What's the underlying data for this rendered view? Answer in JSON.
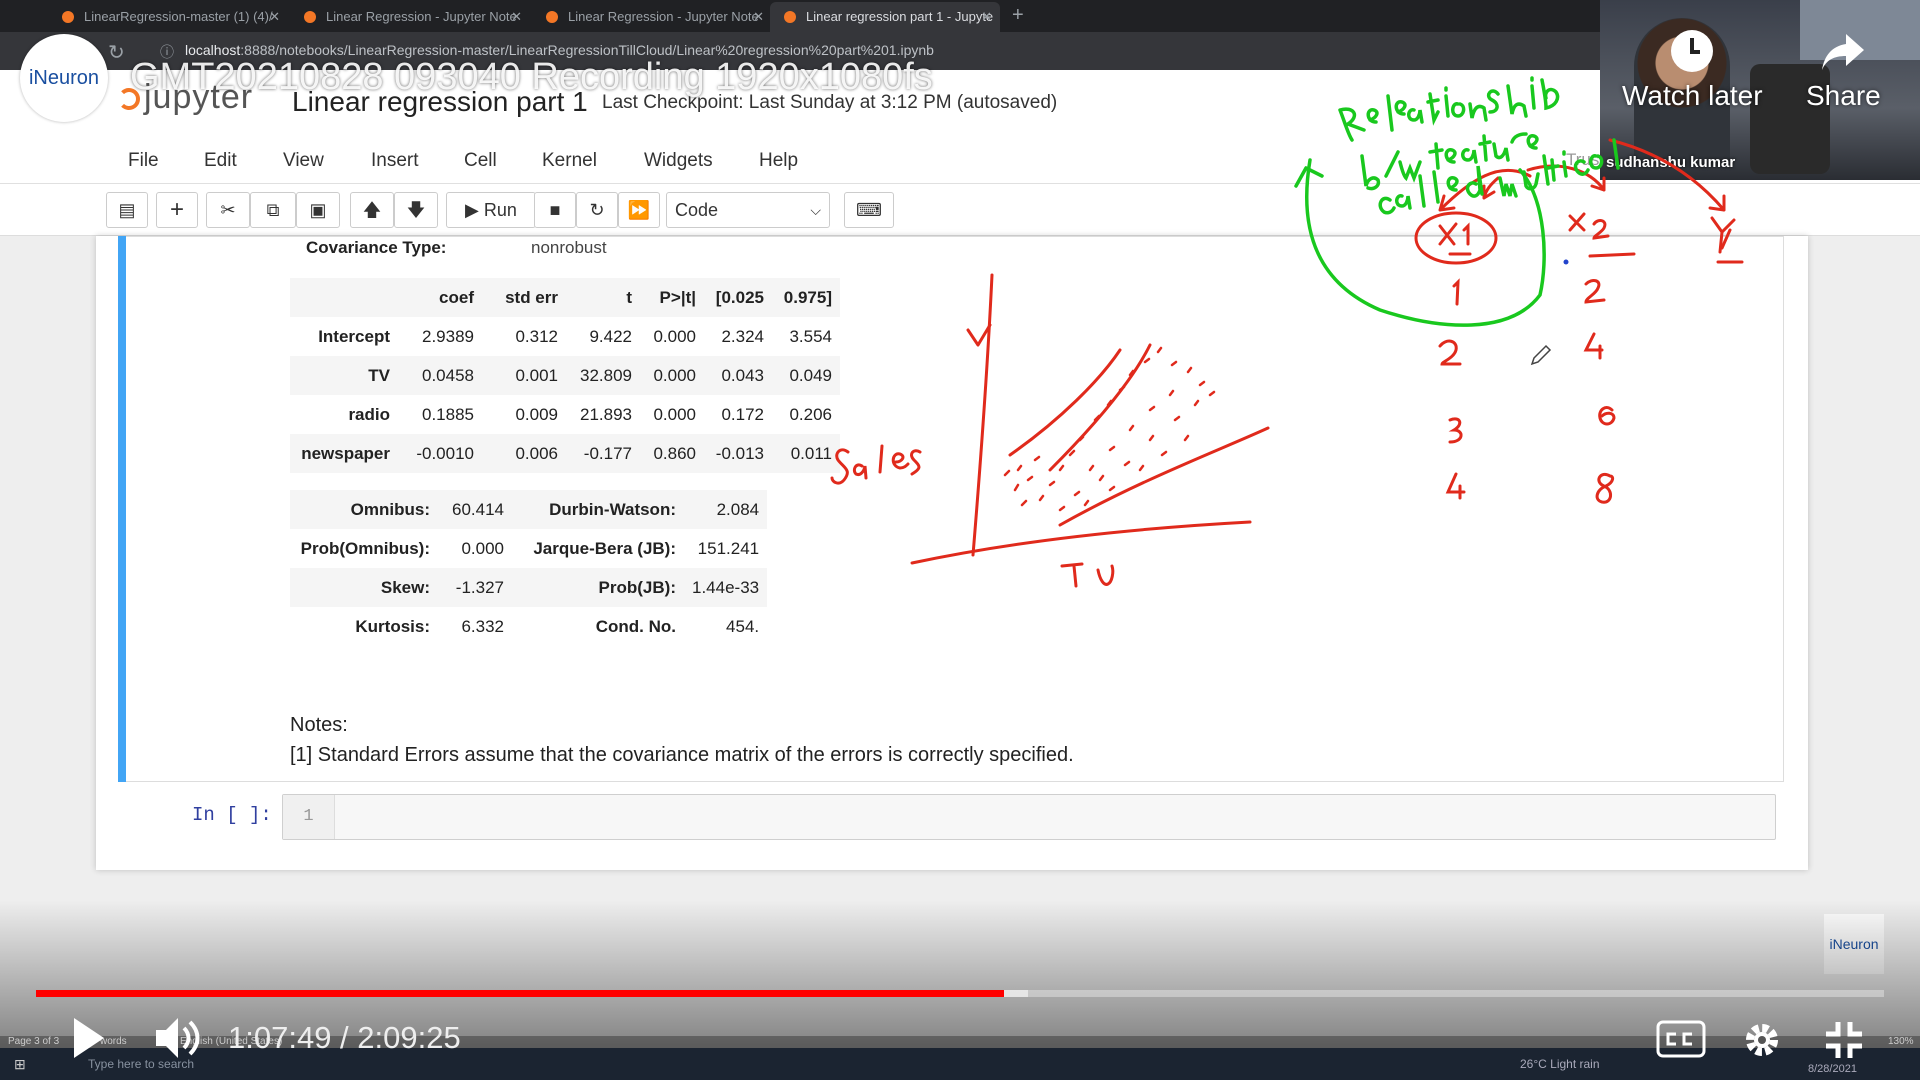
{
  "browser": {
    "tabs": [
      {
        "label": "LinearRegression-master (1) (4)/",
        "active": false
      },
      {
        "label": "Linear Regression - Jupyter Note",
        "active": false
      },
      {
        "label": "Linear Regression - Jupyter Note",
        "active": false
      },
      {
        "label": "Linear regression part 1 - Jupyte",
        "active": true
      }
    ],
    "url_host": "localhost",
    "url_path": ":8888/notebooks/LinearRegression-master/LinearRegressionTillCloud/Linear%20regression%20part%201.ipynb"
  },
  "video": {
    "title": "GMT20210828 093040 Recording 1920x1080fs",
    "channel_logo_text": "iNeuron",
    "watch_later": "Watch later",
    "share": "Share",
    "presenter": "sudhanshu kumar",
    "time_current": "1:07:49",
    "time_total": "2:09:25",
    "time_display": "1:07:49 / 2:09:25",
    "progress_played": 0.524,
    "progress_buffered": 0.537,
    "watermark_text": "iNeuron"
  },
  "jupyter": {
    "logo_text": "jupyter",
    "notebook_title": "Linear regression part 1",
    "checkpoint": "Last Checkpoint: Last Sunday at 3:12 PM  (autosaved)",
    "trusted": "Trus",
    "menu": [
      "File",
      "Edit",
      "View",
      "Insert",
      "Cell",
      "Kernel",
      "Widgets",
      "Help"
    ],
    "run_label": "Run",
    "cell_type": "Code"
  },
  "output": {
    "cov_type_label": "Covariance Type:",
    "cov_type_value": "nonrobust",
    "coef_headers": [
      "",
      "coef",
      "std err",
      "t",
      "P>|t|",
      "[0.025",
      "0.975]"
    ],
    "coef_rows": [
      [
        "Intercept",
        "2.9389",
        "0.312",
        "9.422",
        "0.000",
        "2.324",
        "3.554"
      ],
      [
        "TV",
        "0.0458",
        "0.001",
        "32.809",
        "0.000",
        "0.043",
        "0.049"
      ],
      [
        "radio",
        "0.1885",
        "0.009",
        "21.893",
        "0.000",
        "0.172",
        "0.206"
      ],
      [
        "newspaper",
        "-0.0010",
        "0.006",
        "-0.177",
        "0.860",
        "-0.013",
        "0.011"
      ]
    ],
    "diag_rows": [
      [
        "Omnibus:",
        "60.414",
        "Durbin-Watson:",
        "2.084"
      ],
      [
        "Prob(Omnibus):",
        "0.000",
        "Jarque-Bera (JB):",
        "151.241"
      ],
      [
        "Skew:",
        "-1.327",
        "Prob(JB):",
        "1.44e-33"
      ],
      [
        "Kurtosis:",
        "6.332",
        "Cond. No.",
        "454."
      ]
    ],
    "notes_title": "Notes:",
    "notes_text": "[1] Standard Errors assume that the covariance matrix of the errors is correctly specified."
  },
  "input_cell": {
    "prompt": "In [ ]:",
    "line_number": "1"
  },
  "annotations": {
    "green_text_line1": "Releationship",
    "green_text_line2": "b/w features",
    "green_text_line3": "called multicol",
    "circled": "X1",
    "x2_label": "X2",
    "y_label": "Y",
    "col1": [
      "1",
      "2",
      "3",
      "4"
    ],
    "col2": [
      "2",
      "4",
      "6",
      "8"
    ],
    "sales_label": "Sales",
    "tv_label": "TV",
    "y_axis_mark": "Y",
    "colors": {
      "green": "#19c81e",
      "red": "#e02a1c"
    }
  },
  "taskbar": {
    "search_placeholder": "Type here to search",
    "page_info": "Page 3 of 3",
    "words": "words",
    "lang": "English (United States)",
    "weather": "26°C  Light rain",
    "date": "8/28/2021",
    "zoom": "130%"
  }
}
